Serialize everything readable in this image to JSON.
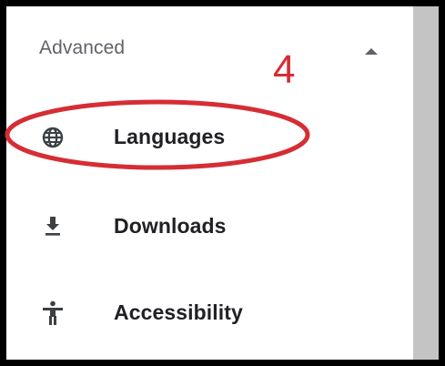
{
  "section": {
    "title": "Advanced",
    "collapse_icon": "chevron-up-icon"
  },
  "items": [
    {
      "label": "Languages",
      "icon": "globe-icon"
    },
    {
      "label": "Downloads",
      "icon": "download-icon"
    },
    {
      "label": "Accessibility",
      "icon": "accessibility-icon"
    }
  ],
  "annotation": {
    "number": "4",
    "color": "#d62d34"
  },
  "colors": {
    "frame_border": "#000000",
    "scroll_area": "#c4c4c4",
    "section_title": "#5f6368",
    "item_text": "#202124",
    "icon": "#3c4043"
  }
}
